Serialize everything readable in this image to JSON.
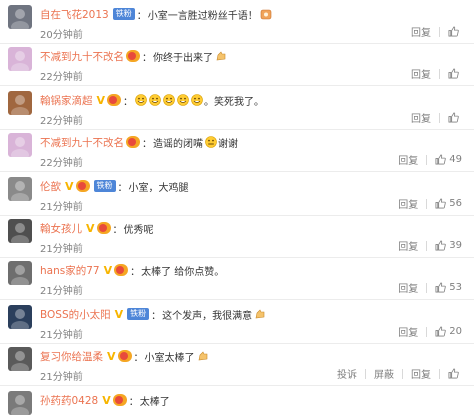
{
  "comments": [
    {
      "user": "自在飞花2013",
      "badge": "铁粉",
      "vip": false,
      "fan_icon": false,
      "text": "小室一言胜过粉丝千语！",
      "emojis": [
        "hands-emoji"
      ],
      "time": "20分钟前",
      "reply": "回复",
      "likes": "",
      "report": "",
      "block": "",
      "avatar_color": "#6f7480"
    },
    {
      "user": "不减到九十不改名",
      "badge": "",
      "vip": false,
      "fan_icon": true,
      "text": "你终于出来了",
      "emojis": [
        "clap-emoji"
      ],
      "time": "22分钟前",
      "reply": "回复",
      "likes": "",
      "report": "",
      "block": "",
      "avatar_color": "#d9b4d8"
    },
    {
      "user": "翰锅家滴超",
      "badge": "",
      "vip": true,
      "fan_icon": true,
      "text": "",
      "emojis": [
        "grin-emoji",
        "grin-emoji",
        "grin-emoji",
        "grin-emoji",
        "grin-emoji"
      ],
      "text_after": "。笑死我了。",
      "time": "22分钟前",
      "reply": "回复",
      "likes": "",
      "report": "",
      "block": "",
      "avatar_color": "#a0673f"
    },
    {
      "user": "不减到九十不改名",
      "badge": "",
      "vip": false,
      "fan_icon": true,
      "text": "造谣的闭嘴",
      "emojis": [
        "zip-mouth-emoji"
      ],
      "text_after": " 谢谢",
      "time": "22分钟前",
      "reply": "回复",
      "likes": "49",
      "report": "",
      "block": "",
      "avatar_color": "#d9b4d8"
    },
    {
      "user": "伦歆",
      "badge": "铁粉",
      "vip": true,
      "fan_icon": true,
      "text": "小室，大鸡腿",
      "emojis": [],
      "time": "21分钟前",
      "reply": "回复",
      "likes": "56",
      "report": "",
      "block": "",
      "avatar_color": "#8a8a8a"
    },
    {
      "user": "翰女孩儿",
      "badge": "",
      "vip": true,
      "fan_icon": true,
      "text": "优秀呢",
      "emojis": [],
      "time": "21分钟前",
      "reply": "回复",
      "likes": "39",
      "report": "",
      "block": "",
      "avatar_color": "#4f4f4f"
    },
    {
      "user": "hans家的77",
      "badge": "",
      "vip": true,
      "fan_icon": true,
      "text": "太棒了 给你点赞。",
      "emojis": [],
      "time": "21分钟前",
      "reply": "回复",
      "likes": "53",
      "report": "",
      "block": "",
      "avatar_color": "#6e6e6e"
    },
    {
      "user": "BOSS的小太阳",
      "badge": "铁粉",
      "vip": true,
      "fan_icon": false,
      "text": "这个发声，我很满意",
      "emojis": [
        "clap-emoji"
      ],
      "time": "21分钟前",
      "reply": "回复",
      "likes": "20",
      "report": "",
      "block": "",
      "avatar_color": "#2b3f5c"
    },
    {
      "user": "复习你给温柔",
      "badge": "",
      "vip": true,
      "fan_icon": true,
      "text": "小室太棒了",
      "emojis": [
        "thumbs-up-emoji"
      ],
      "time": "21分钟前",
      "reply": "回复",
      "likes": "",
      "report": "投诉",
      "block": "屏蔽",
      "avatar_color": "#5a5a5a"
    },
    {
      "user": "孙药药0428",
      "badge": "",
      "vip": true,
      "fan_icon": true,
      "text": "太棒了",
      "emojis": [],
      "time": "",
      "reply": "",
      "likes": "",
      "report": "",
      "block": "",
      "avatar_color": "#7a7a7a"
    }
  ],
  "colors": {
    "username": "#eb7350",
    "badge": "#4e86d8",
    "vip": "#f7b500",
    "meta": "#808080"
  }
}
